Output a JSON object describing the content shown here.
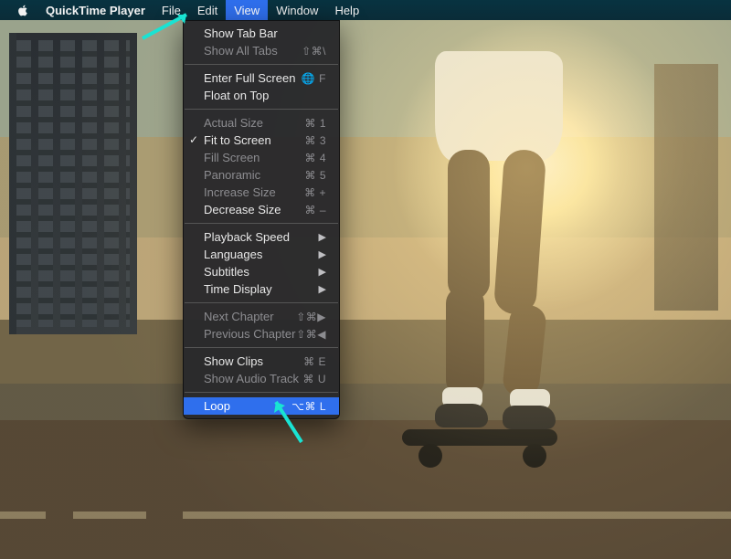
{
  "menubar": {
    "app_title": "QuickTime Player",
    "items": [
      "File",
      "Edit",
      "View",
      "Window",
      "Help"
    ],
    "open_index": 2
  },
  "menu": {
    "sections": [
      [
        {
          "label": "Show Tab Bar",
          "enabled": true
        },
        {
          "label": "Show All Tabs",
          "enabled": false,
          "shortcut": "⇧⌘\\"
        }
      ],
      [
        {
          "label": "Enter Full Screen",
          "enabled": true,
          "shortcut": "🌐 F"
        },
        {
          "label": "Float on Top",
          "enabled": true
        }
      ],
      [
        {
          "label": "Actual Size",
          "enabled": false,
          "shortcut": "⌘ 1"
        },
        {
          "label": "Fit to Screen",
          "enabled": true,
          "checked": true,
          "shortcut": "⌘ 3"
        },
        {
          "label": "Fill Screen",
          "enabled": false,
          "shortcut": "⌘ 4"
        },
        {
          "label": "Panoramic",
          "enabled": false,
          "shortcut": "⌘ 5"
        },
        {
          "label": "Increase Size",
          "enabled": false,
          "shortcut": "⌘ +"
        },
        {
          "label": "Decrease Size",
          "enabled": true,
          "shortcut": "⌘ –"
        }
      ],
      [
        {
          "label": "Playback Speed",
          "enabled": true,
          "submenu": true
        },
        {
          "label": "Languages",
          "enabled": true,
          "submenu": true
        },
        {
          "label": "Subtitles",
          "enabled": true,
          "submenu": true
        },
        {
          "label": "Time Display",
          "enabled": true,
          "submenu": true
        }
      ],
      [
        {
          "label": "Next Chapter",
          "enabled": false,
          "shortcut": "⇧⌘▶"
        },
        {
          "label": "Previous Chapter",
          "enabled": false,
          "shortcut": "⇧⌘◀"
        }
      ],
      [
        {
          "label": "Show Clips",
          "enabled": true,
          "shortcut": "⌘ E"
        },
        {
          "label": "Show Audio Track",
          "enabled": false,
          "shortcut": "⌘ U"
        }
      ],
      [
        {
          "label": "Loop",
          "enabled": true,
          "highlighted": true,
          "shortcut": "⌥⌘ L"
        }
      ]
    ]
  },
  "annotations": {
    "arrow_to_view": true,
    "arrow_to_loop": true
  },
  "colors": {
    "highlight": "#2f6fed",
    "annotation": "#19e3d3"
  }
}
